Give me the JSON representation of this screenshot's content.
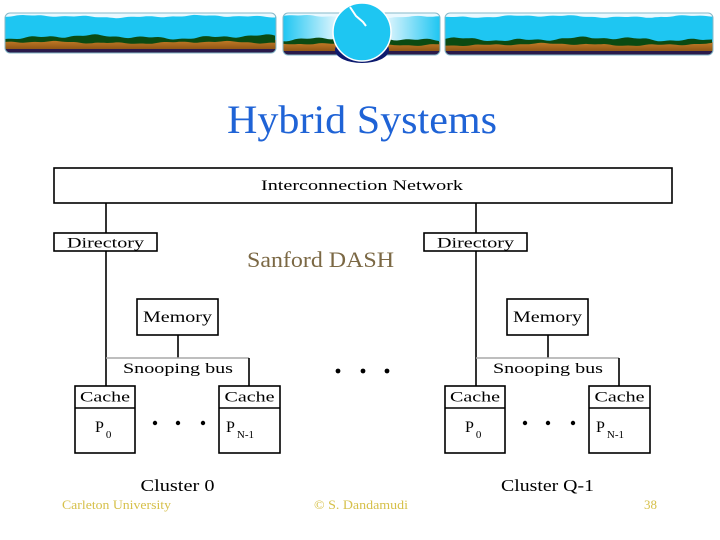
{
  "slide": {
    "title": "Hybrid Systems",
    "subtitle": "Sanford DASH"
  },
  "diagram": {
    "network_label": "Interconnection Network",
    "between_clusters_ellipsis": "...",
    "clusters": [
      {
        "name": "Cluster 0",
        "directory": "Directory",
        "memory": "Memory",
        "bus": "Snooping bus",
        "nodes": [
          {
            "cache": "Cache",
            "processor": "P",
            "processor_sub": "0"
          },
          {
            "cache": "Cache",
            "processor": "P",
            "processor_sub": "N-1"
          }
        ],
        "ellipsis": "..."
      },
      {
        "name": "Cluster Q-1",
        "directory": "Directory",
        "memory": "Memory",
        "bus": "Snooping bus",
        "nodes": [
          {
            "cache": "Cache",
            "processor": "P",
            "processor_sub": "0"
          },
          {
            "cache": "Cache",
            "processor": "P",
            "processor_sub": "N-1"
          }
        ],
        "ellipsis": "..."
      }
    ]
  },
  "footer": {
    "left": "Carleton University",
    "center": "© S. Dandamudi",
    "page_number": "38"
  },
  "colors": {
    "title": "#1f63d6",
    "subtitle": "#7b6844",
    "footer": "#d6c04a",
    "sky": "#1ec6f2",
    "hills": "#0b4a12",
    "soil": "#b5701f",
    "banner_base": "#2a1a4a"
  }
}
